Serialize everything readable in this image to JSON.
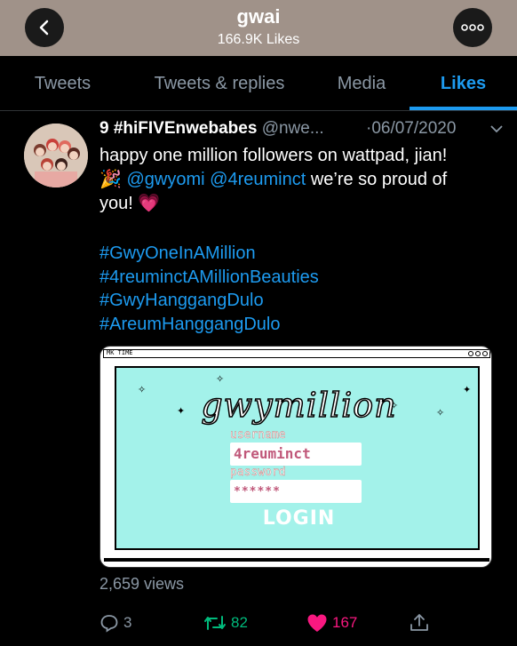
{
  "header": {
    "title": "gwai",
    "subtitle": "166.9K Likes"
  },
  "tabs": [
    {
      "label": "Tweets"
    },
    {
      "label": "Tweets & replies"
    },
    {
      "label": "Media"
    },
    {
      "label": "Likes",
      "active": true
    }
  ],
  "tweet": {
    "author_name": "9 #hiFIVEnwebabes",
    "handle": "@nwe...",
    "date": "·06/07/2020",
    "text_line1": "happy one million followers on wattpad, jian!",
    "text_line2_emoji": "🎉",
    "mention1": "@gwyomi",
    "mention2": "@4reuminct",
    "text_line2_rest": " we’re so proud of",
    "text_line3": "you! ",
    "text_line3_emoji": "💗",
    "hashtags": [
      "#GwyOneInAMillion",
      "#4reuminctAMillionBeauties",
      "#GwyHanggangDulo",
      "#AreumHanggangDulo"
    ],
    "views": "2,659 views",
    "replies": "3",
    "retweets": "82",
    "likes": "167"
  },
  "media": {
    "window_title": "MK TIME",
    "logo_text": "gwymillion",
    "username_label": "username",
    "username_value": "4reuminct",
    "password_label": "password",
    "password_value": "******",
    "login_label": "LOGIN"
  },
  "colors": {
    "header_bg": "#a09289",
    "accent": "#1d9bf0",
    "retweet_green": "#00ba7c",
    "like_pink": "#f91880",
    "muted": "#8b98a5",
    "media_bg": "#a3f2ea"
  }
}
